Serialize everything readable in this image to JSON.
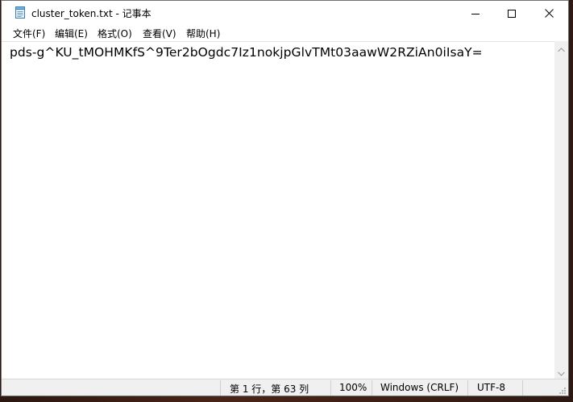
{
  "window": {
    "title": "cluster_token.txt - 记事本",
    "icons": {
      "app": "notepad-icon",
      "minimize": "minimize-icon",
      "maximize": "maximize-icon",
      "close": "close-icon"
    }
  },
  "menu": {
    "items": [
      {
        "label": "文件(F)"
      },
      {
        "label": "编辑(E)"
      },
      {
        "label": "格式(O)"
      },
      {
        "label": "查看(V)"
      },
      {
        "label": "帮助(H)"
      }
    ]
  },
  "editor": {
    "content": "pds-g^KU_tMOHMKfS^9Ter2bOgdc7Iz1nokjpGlvTMt03aawW2RZiAn0iIsaY="
  },
  "status": {
    "position": "第 1 行，第 63 列",
    "zoom": "100%",
    "line_ending": "Windows (CRLF)",
    "encoding": "UTF-8"
  },
  "colors": {
    "window_bg": "#ffffff",
    "statusbar_bg": "#f0f0f0",
    "text": "#000000"
  }
}
